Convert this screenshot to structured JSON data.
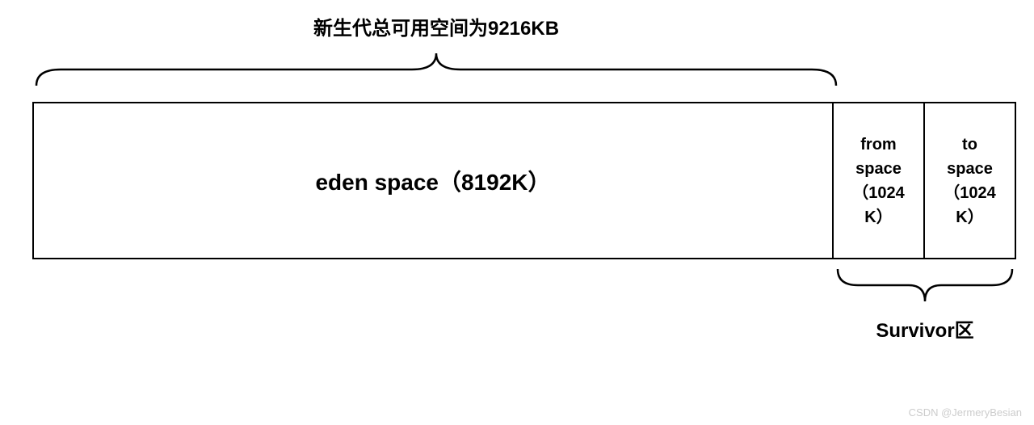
{
  "top_label": "新生代总可用空间为9216KB",
  "eden": {
    "label": "eden space（8192K）"
  },
  "from": {
    "line1": "from",
    "line2": "space",
    "line3": "（1024",
    "line4": "K）"
  },
  "to": {
    "line1": "to",
    "line2": "space",
    "line3": "（1024",
    "line4": "K）"
  },
  "bottom_label": "Survivor区",
  "watermark": "CSDN @JermeryBesian",
  "chart_data": {
    "type": "bar",
    "title": "JVM Young Generation Memory Layout",
    "total_usable_young_kb": 9216,
    "regions": [
      {
        "name": "eden space",
        "size_kb": 8192
      },
      {
        "name": "from space (Survivor)",
        "size_kb": 1024
      },
      {
        "name": "to space (Survivor)",
        "size_kb": 1024
      }
    ],
    "survivor_group": [
      "from space",
      "to space"
    ]
  }
}
